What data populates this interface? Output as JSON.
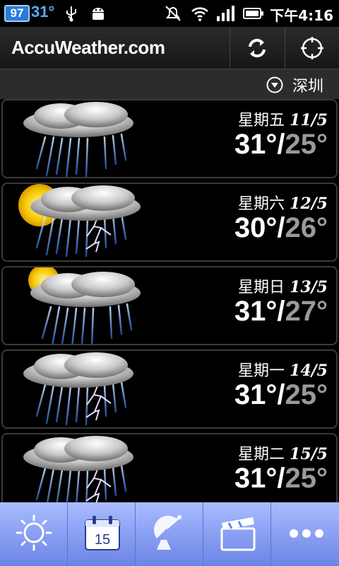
{
  "status_bar": {
    "badge": "97",
    "temperature": "31°",
    "icons": [
      "usb-icon",
      "android-debug-icon",
      "mute-icon",
      "wifi-icon",
      "signal-icon",
      "battery-icon"
    ],
    "time": "下午4:16"
  },
  "header": {
    "brand": "AccuWeather.com",
    "refresh_icon": "refresh-icon",
    "locate_icon": "crosshair-icon"
  },
  "location": {
    "name": "深圳",
    "icon": "dropdown-circle-icon"
  },
  "forecast": [
    {
      "day": "星期五",
      "date": "11/5",
      "high": "31°",
      "low": "25°",
      "icon": "rain-icon"
    },
    {
      "day": "星期六",
      "date": "12/5",
      "high": "30°",
      "low": "26°",
      "icon": "sun-thunderstorm-icon"
    },
    {
      "day": "星期日",
      "date": "13/5",
      "high": "31°",
      "low": "27°",
      "icon": "sun-cloud-rain-icon"
    },
    {
      "day": "星期一",
      "date": "14/5",
      "high": "31°",
      "low": "25°",
      "icon": "thunderstorm-icon"
    },
    {
      "day": "星期二",
      "date": "15/5",
      "high": "31°",
      "low": "25°",
      "icon": "thunderstorm-icon"
    }
  ],
  "tabs": [
    {
      "icon": "sun-icon"
    },
    {
      "icon": "calendar-icon",
      "label": "15"
    },
    {
      "icon": "satellite-dish-icon"
    },
    {
      "icon": "clapperboard-icon"
    },
    {
      "icon": "more-icon"
    }
  ],
  "colors": {
    "low_temp": "#9a9a9a",
    "tabbar_top": "#a9bcff",
    "tabbar_bottom": "#6b84e6",
    "status_temp": "#5aa9ff"
  }
}
